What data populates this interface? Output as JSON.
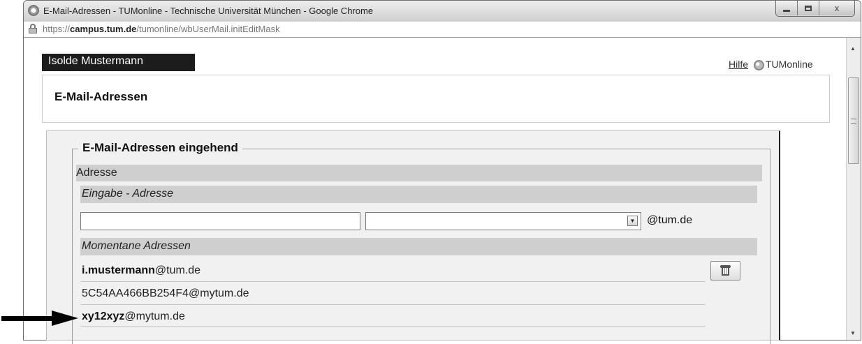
{
  "browser": {
    "window_title": "E-Mail-Adressen - TUMonline - Technische Universität München - Google Chrome",
    "url_prefix": "https://",
    "url_domain": "campus.tum.de",
    "url_path": "/tumonline/wbUserMail.initEditMask",
    "close_glyph": "x"
  },
  "header": {
    "user_name": "Isolde Mustermann",
    "help_link": "Hilfe",
    "logo_text": "TUMonline",
    "page_title": "E-Mail-Adressen"
  },
  "incoming": {
    "section_title": "E-Mail-Adressen eingehend",
    "address_header": "Adresse",
    "input_header": "Eingabe - Adresse",
    "address_input_value": "",
    "domain_select_value": "",
    "domain_suffix": "@tum.de",
    "current_header": "Momentane Adressen",
    "addresses": [
      {
        "bold": "i.mustermann",
        "rest": "@tum.de"
      },
      {
        "bold": "",
        "rest": "5C54AA466BB254F4@mytum.de"
      },
      {
        "bold": "xy12xyz",
        "rest": "@mytum.de"
      }
    ]
  }
}
